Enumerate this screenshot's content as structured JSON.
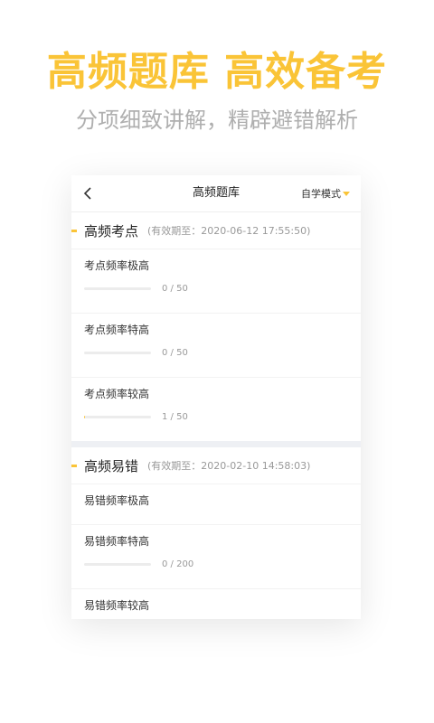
{
  "banner": {
    "headline": "高频题库 高效备考",
    "subline": "分项细致讲解，精辟避错解析"
  },
  "colors": {
    "accent": "#FAC437",
    "muted": "#AFAFAF",
    "track": "#ECECEC"
  },
  "navbar": {
    "back_icon": "chevron-left-icon",
    "title": "高频题库",
    "mode_label": "自学模式",
    "mode_icon": "caret-down-icon"
  },
  "sections": [
    {
      "title": "高频考点",
      "validity": "(有效期至：2020-06-12 17:55:50)",
      "items": [
        {
          "label": "考点频率极高",
          "progress_text": "0 / 50",
          "done": 0,
          "total": 50
        },
        {
          "label": "考点频率特高",
          "progress_text": "0 / 50",
          "done": 0,
          "total": 50
        },
        {
          "label": "考点频率较高",
          "progress_text": "1 / 50",
          "done": 1,
          "total": 50
        }
      ]
    },
    {
      "title": "高频易错",
      "validity": "(有效期至：2020-02-10 14:58:03)",
      "items": [
        {
          "label": "易错频率极高"
        },
        {
          "label": "易错频率特高",
          "progress_text": "0 / 200",
          "done": 0,
          "total": 200
        },
        {
          "label": "易错频率较高"
        }
      ]
    }
  ]
}
